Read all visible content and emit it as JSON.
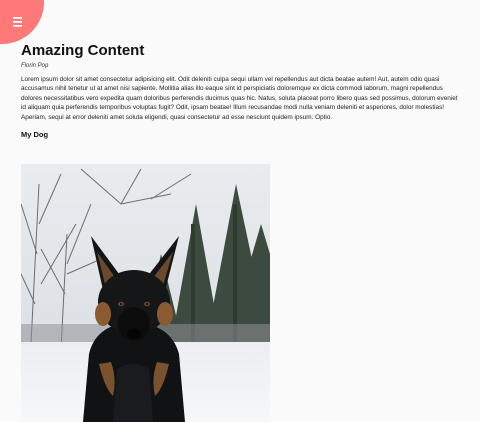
{
  "menu": {
    "icon": "hamburger-menu-icon",
    "accent_color": "#ff7979"
  },
  "article": {
    "title": "Amazing Content",
    "author": "Florin Pop",
    "body": "Lorem ipsum dolor sit amet consectetur adipisicing elit. Odit deleniti culpa sequi ullam vel repellendus aut dicta beatae autem! Aut, autem odio quasi accusamus nihil tenetur ut at amet nisi sapiente. Mollitia alias illo eaque sint id perspiciatis doloremque ex dicta commodi laborum, magni repellendus dolores necessitatibus vero expedita quam doloribus perferendis ducimus quas hic. Natus, soluta placeat porro libero quas sed possimus, dolorum eveniet id aliquam quia perferendis temporibus voluptas fugit? Odit, ipsam beatae! Illum recusandae modi nulla veniam deleniti et asperiores, dolor molestias! Aperiam, sequi at error deleniti amet soluta eligendi, quasi consectetur ad esse nesciunt quidem ipsum. Optio.",
    "section_heading": "My Dog"
  },
  "image": {
    "subject": "german-shepherd-dog-in-snow"
  }
}
